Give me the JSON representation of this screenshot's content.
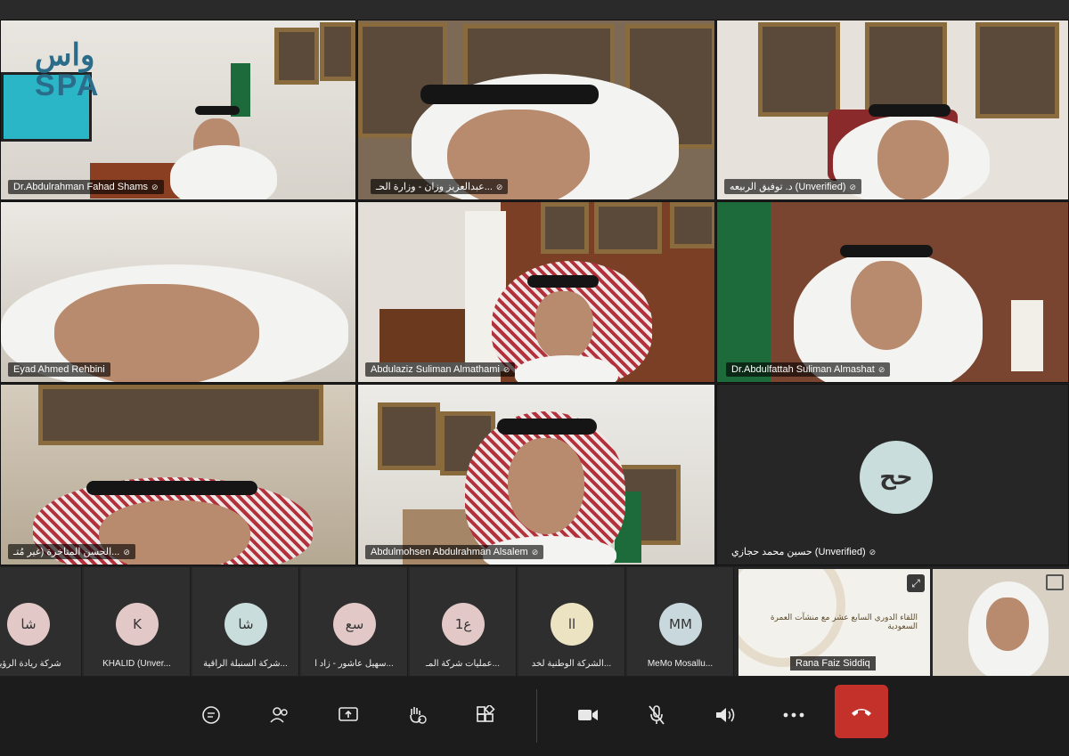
{
  "logo": {
    "line1": "واس",
    "line2": "SPA"
  },
  "tiles": [
    {
      "name": "Dr.Abdulrahman Fahad Shams"
    },
    {
      "name": "عبدالعزيز وزان - وزارة الحـ..."
    },
    {
      "name": "د. توفيق الربيعه (Unverified)"
    },
    {
      "name": "Eyad Ahmed Rehbini"
    },
    {
      "name": "Abdulaziz Suliman Almathami"
    },
    {
      "name": "Dr.Abdulfattah Suliman Almashat"
    },
    {
      "name": "الحسن المتاخرة (غير مُتـ..."
    },
    {
      "name": "Abdulmohsen Abdulrahman Alsalem"
    },
    {
      "name": "حسين محمد حجازي (Unverified)",
      "avatar": "حح"
    }
  ],
  "participants": [
    {
      "initials": "شا",
      "label": "شركة ريادة الرؤية",
      "color": "#e3c8c8"
    },
    {
      "initials": "K",
      "label": "KHALID (Unver...",
      "color": "#e3c8c8"
    },
    {
      "initials": "شا",
      "label": "شركة السنبلة الراقية...",
      "color": "#c9dedc"
    },
    {
      "initials": "سع",
      "label": "سهيل عاشور - زاد ا...",
      "color": "#e3c8c8"
    },
    {
      "initials": "ع1",
      "label": "عمليات شركة المـ...",
      "color": "#e3c8c8"
    },
    {
      "initials": "اا",
      "label": "الشركة الوطنية لخد...",
      "color": "#ece3c3"
    },
    {
      "initials": "MM",
      "label": "MeMo Mosallu...",
      "color": "#c9d8dc"
    }
  ],
  "share": {
    "title": "اللقاء الدوري السابع عشر مع منشآت العمرة السعودية",
    "subtitle": "",
    "presenter": "Rana Faiz Siddiq"
  },
  "toolbar": {
    "chat": "chat-icon",
    "people": "people-icon",
    "share": "share-screen-icon",
    "react": "raise-hand-icon",
    "apps": "apps-icon",
    "camera": "camera-icon",
    "mic": "mic-off-icon",
    "speaker": "speaker-icon",
    "more": "more-icon",
    "leave": "hang-up-icon"
  },
  "colors": {
    "leave": "#c4312b",
    "background": "#1f1f1f"
  }
}
